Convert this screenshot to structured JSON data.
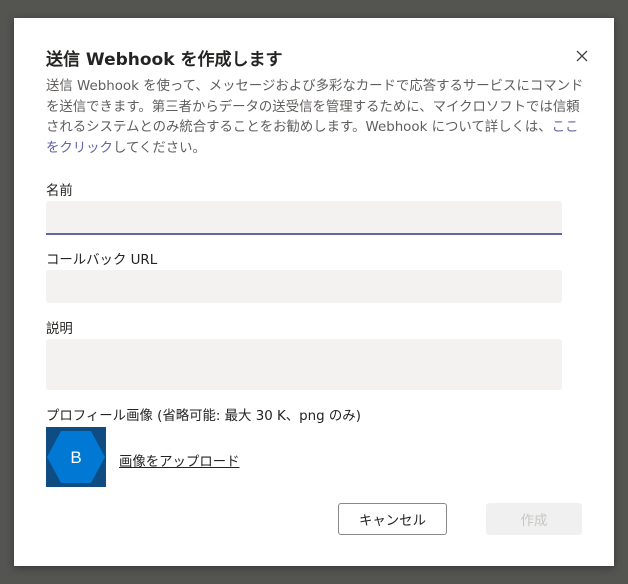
{
  "dialog": {
    "title": "送信 Webhook を作成します",
    "description_pre": "送信 Webhook を使って、メッセージおよび多彩なカードで応答するサービスにコマンドを送信できます。第三者からデータの送受信を管理するために、マイクロソフトでは信頼されるシステムとのみ統合することをお勧めします。Webhook について詳しくは、",
    "description_link": "ここをクリック",
    "description_post": "してください。",
    "close_icon": "close-icon"
  },
  "form": {
    "name_label": "名前",
    "name_value": "",
    "callback_label": "コールバック URL",
    "callback_value": "",
    "description_label": "説明",
    "description_value": "",
    "profile_label": "プロフィール画像 (省略可能: 最大 30 K、png のみ)",
    "avatar_letter": "B",
    "avatar_icon": "hexagon-avatar-icon",
    "upload_label": "画像をアップロード"
  },
  "buttons": {
    "cancel": "キャンセル",
    "create": "作成"
  },
  "colors": {
    "accent": "#6264a7",
    "avatar_bg": "#0f4c81",
    "avatar_hex": "#0078d4",
    "overlay": "#545451"
  }
}
